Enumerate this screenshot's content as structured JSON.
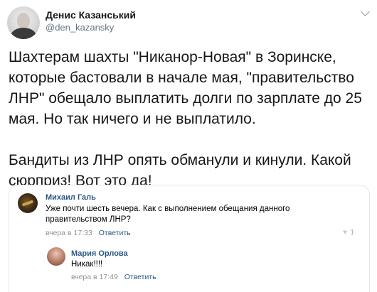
{
  "tweet": {
    "author_name": "Денис Казанський",
    "handle": "@den_kazansky",
    "text": "Шахтерам шахты \"Никанор-Новая\" в Зоринске,\nкоторые бастовали в начале мая, \"правительство\nЛНР\" обещало выплатить долги по зарплате до 25\nмая. Но так ничего и не выплатило.\n\nБандиты из ЛНР опять обманули и кинули. Какой\nсюрприз! Вот это да!"
  },
  "embedded": {
    "comment": {
      "author": "Михаил Галь",
      "text": "Уже почти шесть вечера. Как с выполнением обещания данного\nправительством ЛНР?",
      "time": "вчера в 17:33",
      "reply_label": "Ответить",
      "likes": "1"
    },
    "reply": {
      "author": "Мария Орлова",
      "text": "Никак!!!!",
      "time": "вчера в 17:49",
      "reply_label": "Ответить"
    }
  },
  "icons": {
    "chevron": "chevron-down-icon",
    "like": "heart-icon"
  }
}
